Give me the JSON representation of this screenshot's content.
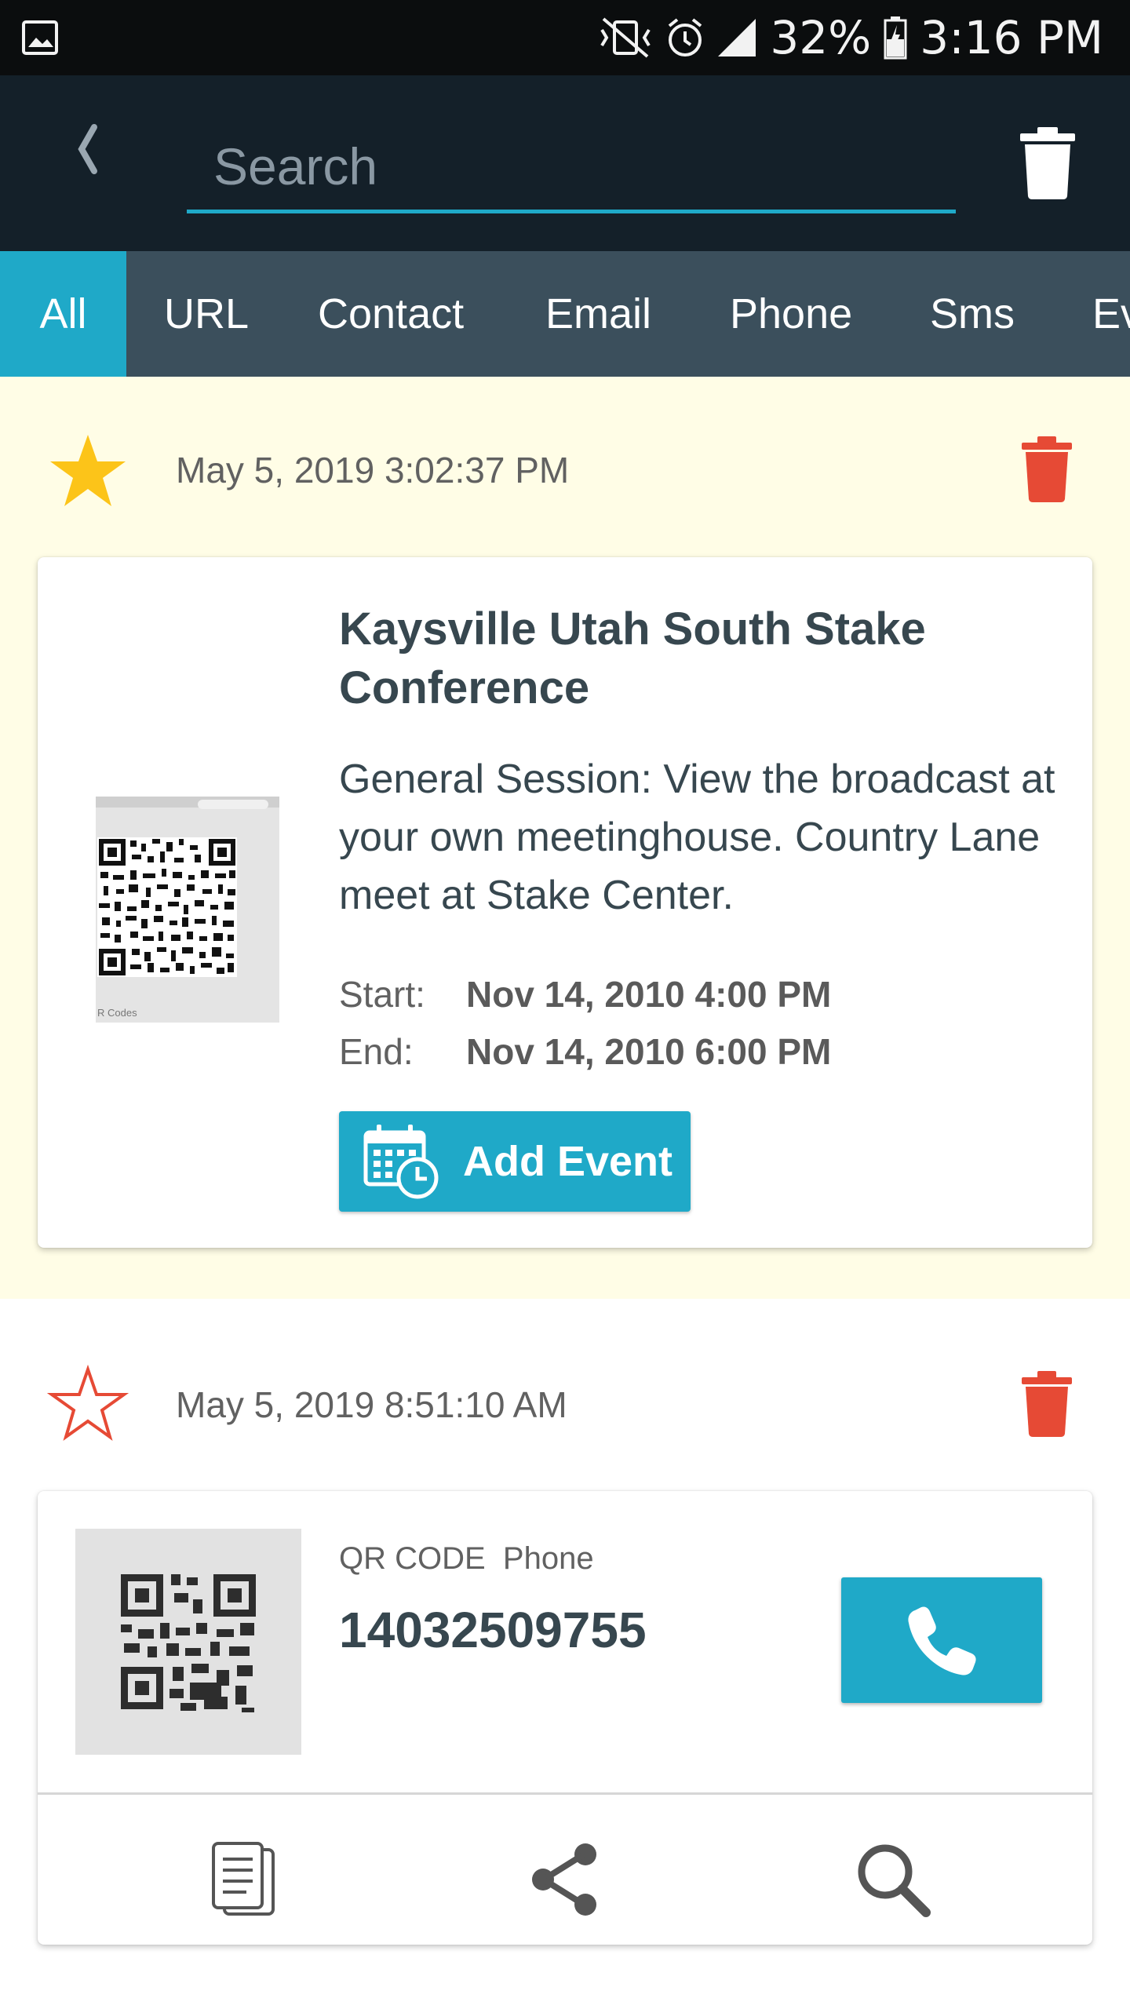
{
  "status_bar": {
    "battery": "32%",
    "time": "3:16 PM",
    "icons": [
      "image-icon",
      "mute-vibrate-icon",
      "alarm-icon",
      "signal-icon",
      "battery-icon"
    ]
  },
  "toolbar": {
    "search_placeholder": "Search",
    "search_value": "",
    "icons": [
      "back-icon",
      "trash-icon"
    ]
  },
  "tabs": [
    {
      "label": "All",
      "active": true
    },
    {
      "label": "URL",
      "active": false
    },
    {
      "label": "Contact",
      "active": false
    },
    {
      "label": "Email",
      "active": false
    },
    {
      "label": "Phone",
      "active": false
    },
    {
      "label": "Sms",
      "active": false
    },
    {
      "label": "Ev",
      "active": false
    }
  ],
  "colors": {
    "accent": "#1fa9c8",
    "toolbar": "#142029",
    "tabbar": "#3b4f5c",
    "favorite_bg": "#fffde6",
    "star_gold": "#fcc419",
    "delete_red": "#e64a35"
  },
  "items": [
    {
      "favorite": true,
      "timestamp": "May 5, 2019 3:02:37 PM",
      "event": {
        "title": "Kaysville Utah South Stake Conference",
        "description": "General Session: View the broadcast at your own meetinghouse. Country Lane meet at Stake Center.",
        "start_label": "Start:",
        "start_value": "Nov 14, 2010 4:00 PM",
        "end_label": "End:",
        "end_value": "Nov 14, 2010 6:00 PM",
        "button_label": "Add Event",
        "thumb_caption": "R Codes"
      }
    },
    {
      "favorite": false,
      "timestamp": "May 5, 2019 8:51:10 AM",
      "phone": {
        "code_type": "QR CODE",
        "content_type": "Phone",
        "number": "14032509755"
      },
      "actions": [
        "copy-icon",
        "share-icon",
        "search-icon"
      ]
    }
  ]
}
